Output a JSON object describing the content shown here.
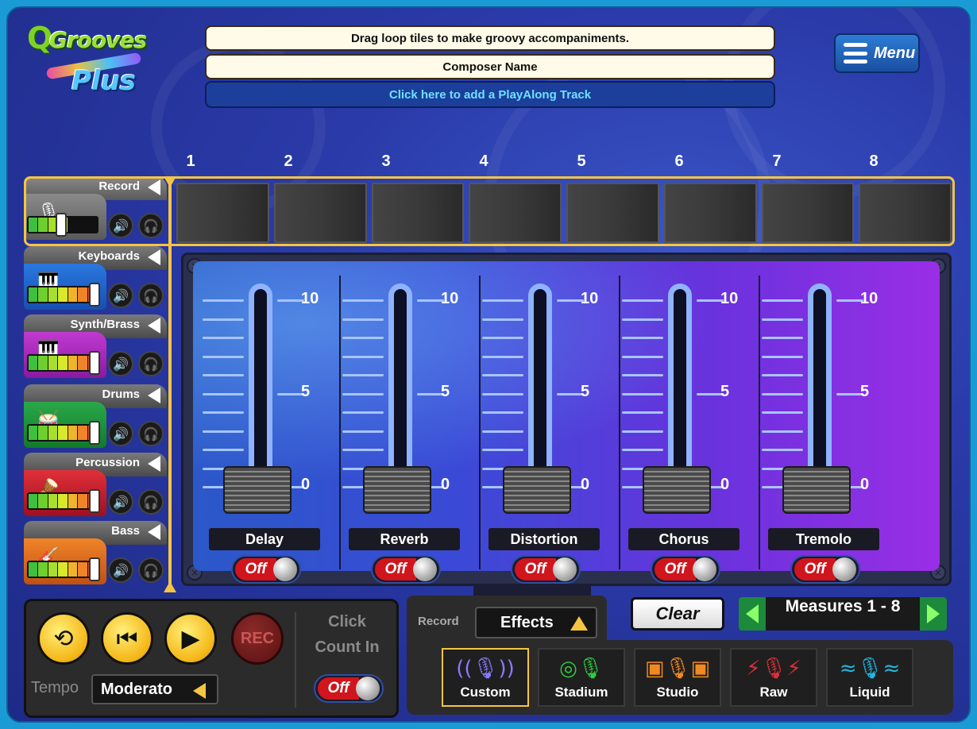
{
  "header": {
    "logo_q": "Q",
    "logo_grooves": "Grooves",
    "logo_plus": "Plus",
    "instructions": "Drag loop tiles to make groovy accompaniments.",
    "composer": "Composer Name",
    "playalong": "Click here to add a PlayAlong Track",
    "menu_label": "Menu"
  },
  "measure_numbers": [
    "1",
    "2",
    "3",
    "4",
    "5",
    "6",
    "7",
    "8"
  ],
  "tracks": [
    {
      "name": "Record",
      "icon": "microphone-icon"
    },
    {
      "name": "Keyboards",
      "icon": "keyboard-icon"
    },
    {
      "name": "Synth/Brass",
      "icon": "synth-icon"
    },
    {
      "name": "Drums",
      "icon": "drums-icon"
    },
    {
      "name": "Percussion",
      "icon": "congas-icon"
    },
    {
      "name": "Bass",
      "icon": "bass-guitar-icon"
    }
  ],
  "effects": [
    {
      "name": "Delay",
      "state": "Off",
      "level": 0
    },
    {
      "name": "Reverb",
      "state": "Off",
      "level": 0
    },
    {
      "name": "Distortion",
      "state": "Off",
      "level": 0
    },
    {
      "name": "Chorus",
      "state": "Off",
      "level": 0
    },
    {
      "name": "Tremolo",
      "state": "Off",
      "level": 0
    }
  ],
  "fader_scale": {
    "top": "10",
    "mid": "5",
    "bottom": "0"
  },
  "transport": {
    "rec": "REC",
    "click_line1": "Click",
    "click_line2": "Count In",
    "click_state": "Off",
    "tempo_label": "Tempo",
    "tempo_value": "Moderato"
  },
  "fx_select": {
    "record_label": "Record",
    "dropdown": "Effects",
    "presets": [
      {
        "name": "Custom",
        "icon": "custom-mic-icon",
        "color": "#8a7aff"
      },
      {
        "name": "Stadium",
        "icon": "stadium-mic-icon",
        "color": "#2ecc40"
      },
      {
        "name": "Studio",
        "icon": "studio-mic-icon",
        "color": "#f08a20"
      },
      {
        "name": "Raw",
        "icon": "raw-mic-icon",
        "color": "#e0303a"
      },
      {
        "name": "Liquid",
        "icon": "liquid-mic-icon",
        "color": "#20b8e0"
      }
    ]
  },
  "clear_label": "Clear",
  "measures_label": "Measures 1 - 8",
  "colors": {
    "accent": "#f5c542",
    "toggle_off": "#d0151d",
    "panel_dark": "#2b2b2b"
  }
}
